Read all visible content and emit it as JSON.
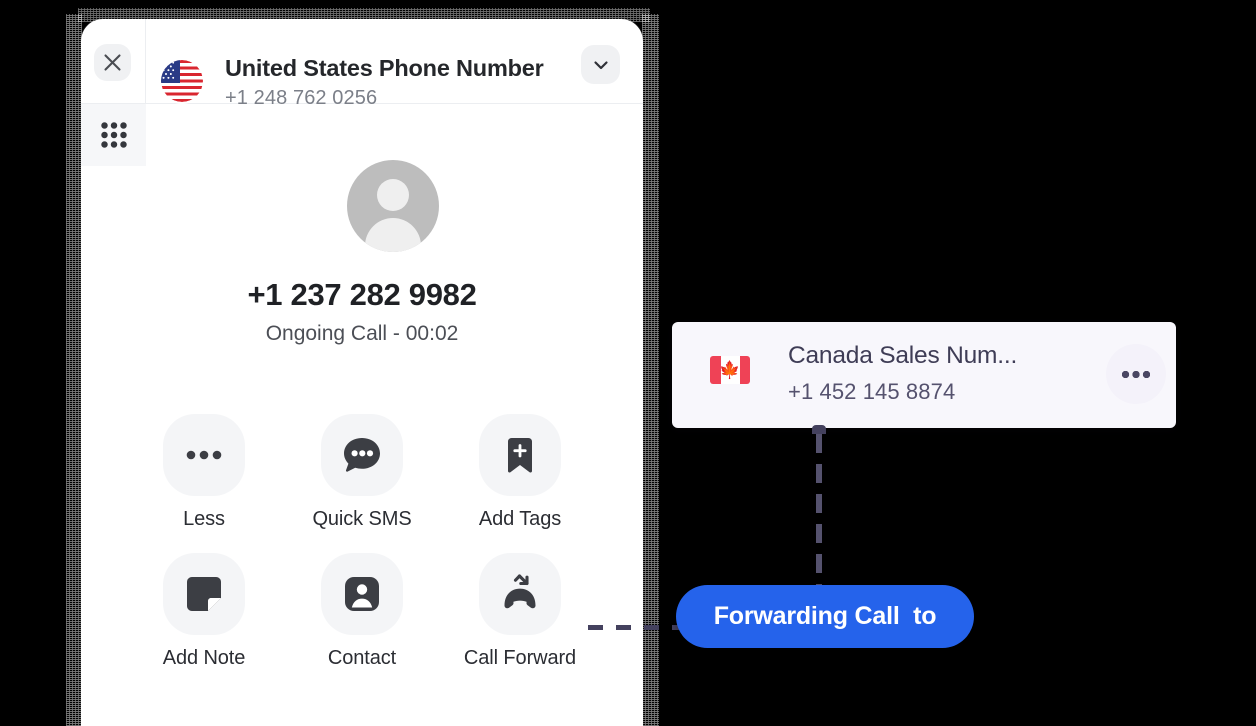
{
  "window": {
    "background_color": "#000000",
    "panel_background": "#ffffff"
  },
  "header": {
    "close_icon": "close-icon",
    "flag_icon": "us-flag-icon",
    "title": "United States Phone Number",
    "phone_number": "+1 248 762 0256",
    "chevron_icon": "chevron-down-icon"
  },
  "sidebar": {
    "dialpad_icon": "dialpad-grid-icon"
  },
  "call": {
    "avatar_icon": "avatar-placeholder-icon",
    "number": "+1 237 282 9982",
    "status": "Ongoing Call - 00:02"
  },
  "actions": [
    {
      "id": "less",
      "label": "Less",
      "icon": "ellipsis-icon"
    },
    {
      "id": "quick-sms",
      "label": "Quick SMS",
      "icon": "chat-bubble-icon"
    },
    {
      "id": "add-tags",
      "label": "Add Tags",
      "icon": "bookmark-plus-icon"
    },
    {
      "id": "add-note",
      "label": "Add Note",
      "icon": "sticky-note-icon"
    },
    {
      "id": "contact",
      "label": "Contact",
      "icon": "contact-person-icon"
    },
    {
      "id": "call-forward",
      "label": "Call Forward",
      "icon": "call-forward-icon"
    }
  ],
  "forward_target": {
    "flag_icon": "canada-flag-icon",
    "title": "Canada Sales Num...",
    "phone_number": "+1 452 145 8874",
    "more_icon": "more-options-icon",
    "card_color": "#f8f7fc"
  },
  "forwarding_banner": {
    "label": "Forwarding Call  to",
    "color": "#2563eb"
  }
}
